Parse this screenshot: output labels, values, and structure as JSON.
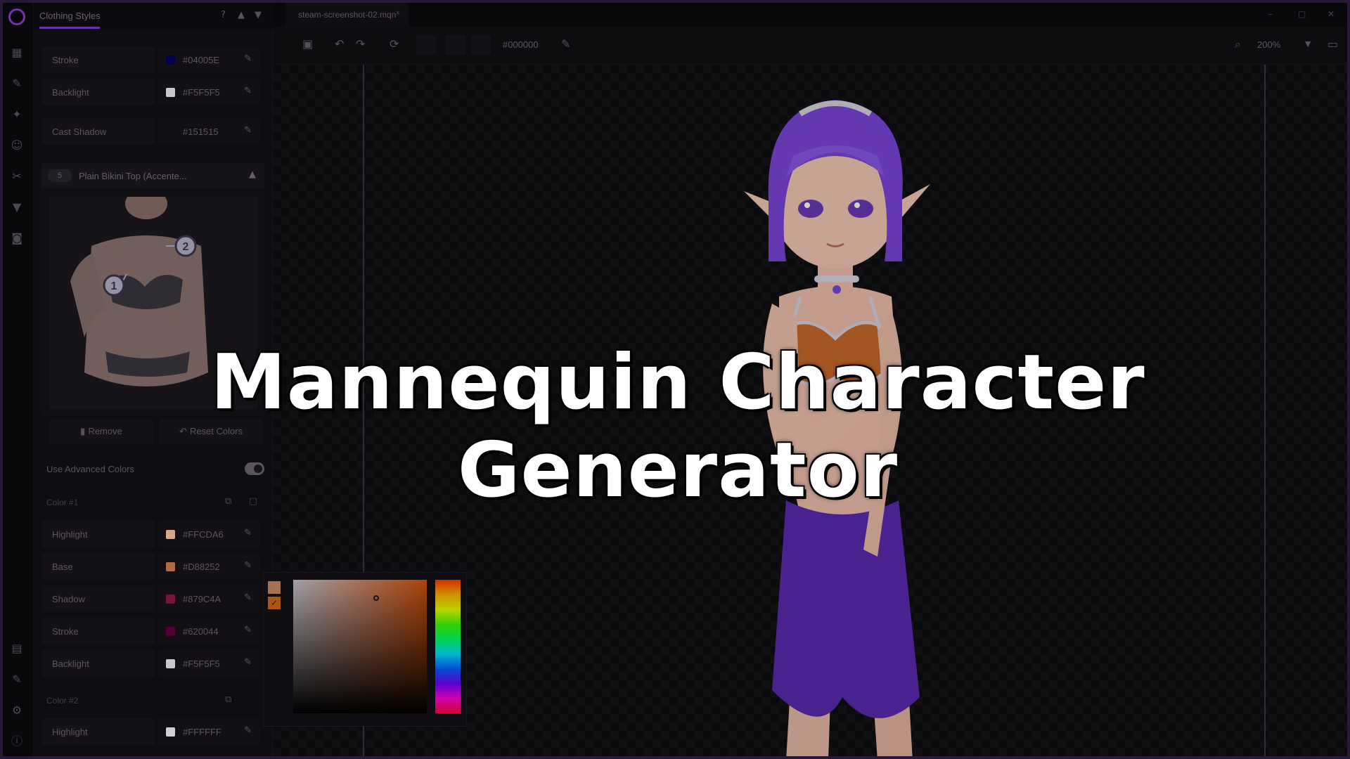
{
  "panel": {
    "title": "Clothing Styles",
    "top_rows": [
      {
        "label": "Stroke",
        "hex": "#04005E",
        "color": "#04005E"
      },
      {
        "label": "Backlight",
        "hex": "#F5F5F5",
        "color": "#F5F5F5"
      },
      {
        "label": "Cast Shadow",
        "hex": "#151515",
        "color": "#151515"
      }
    ],
    "item": {
      "badge": "5",
      "name": "Plain Bikini Top (Accente...",
      "callouts": [
        "1",
        "2"
      ]
    },
    "buttons": {
      "remove": "Remove",
      "reset": "Reset Colors"
    },
    "advanced_colors_label": "Use Advanced Colors",
    "advanced_colors_enabled": true,
    "color1": {
      "label": "Color #1",
      "rows": [
        {
          "label": "Highlight",
          "hex": "#FFCDA6",
          "color": "#FFCDA6"
        },
        {
          "label": "Base",
          "hex": "#D88252",
          "color": "#D88252"
        },
        {
          "label": "Shadow",
          "hex": "#879C4A",
          "color": "#8A1C4A"
        },
        {
          "label": "Stroke",
          "hex": "#620044",
          "color": "#620044"
        },
        {
          "label": "Backlight",
          "hex": "#F5F5F5",
          "color": "#F5F5F5"
        }
      ]
    },
    "color2": {
      "label": "Color #2",
      "rows": [
        {
          "label": "Highlight",
          "hex": "#FFFFFF",
          "color": "#FFFFFF"
        }
      ]
    }
  },
  "tab": {
    "label": "steam-screenshot-02.mqn"
  },
  "toolbar": {
    "hex": "#000000",
    "zoom": "200%"
  },
  "overlay_title": "Mannequin Character Generator",
  "colors": {
    "accent": "#7E3ED0",
    "hair": "#7A45D8",
    "skirt": "#5A2AB0",
    "top": "#C86A2A"
  }
}
